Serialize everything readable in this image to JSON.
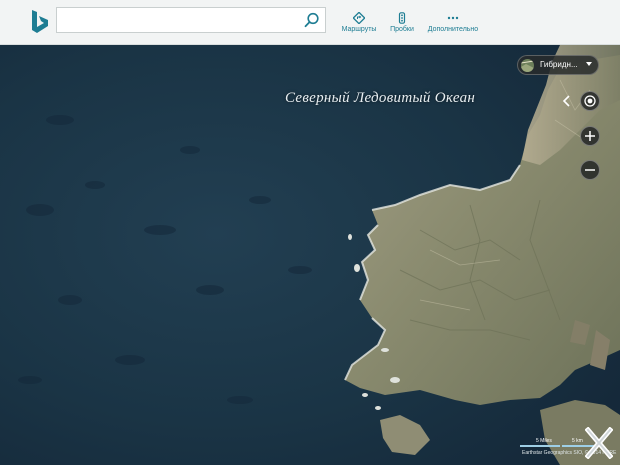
{
  "search": {
    "value": "",
    "placeholder": ""
  },
  "toolbar": {
    "routes_label": "Маршруты",
    "traffic_label": "Пробки",
    "more_label": "Дополнительно"
  },
  "map": {
    "ocean_label": "Северный Ледовитый Океан",
    "layer_label": "Гибридн...",
    "scale_miles": "5 Miles",
    "scale_km": "5 km",
    "attribution": "Earthstar Geographics SIO, © 2014 HERE"
  },
  "icons": {
    "logo": "bing-logo-icon",
    "search": "search-icon",
    "routes": "directions-icon",
    "traffic": "traffic-light-icon",
    "more": "more-dots-icon",
    "locate": "locate-me-icon",
    "zoom_in": "plus-icon",
    "zoom_out": "minus-icon",
    "collapse": "chevron-left-icon",
    "close": "close-icon"
  },
  "colors": {
    "accent": "#1e7d93",
    "ocean": "#1b3546",
    "land": "#8c8d74",
    "control_bg": "#262a2a"
  }
}
